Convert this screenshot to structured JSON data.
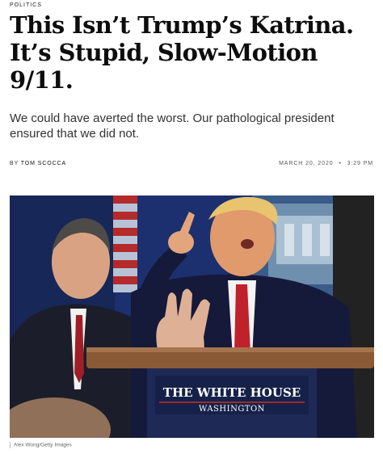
{
  "article": {
    "section": "POLITICS",
    "headline": "This Isn’t Trump’s Katrina. It’s Stupid, Slow-Motion 9/11.",
    "dek": "We could have averted the worst. Our pathological president ensured that we did not.",
    "byline_prefix": "BY",
    "author": "TOM SCOCCA",
    "date": "MARCH 20, 2020",
    "separator": "•",
    "time": "3:29 PM"
  },
  "image": {
    "podium_line1": "THE WHITE HOUSE",
    "podium_line2": "WASHINGTON",
    "credit": "Alex Wong/Getty Images"
  },
  "colors": {
    "headline": "#0d0d0d",
    "backdrop_blue": "#1c2f6e",
    "podium_wood": "#8a5a36",
    "podium_panel": "#1e2a55"
  }
}
